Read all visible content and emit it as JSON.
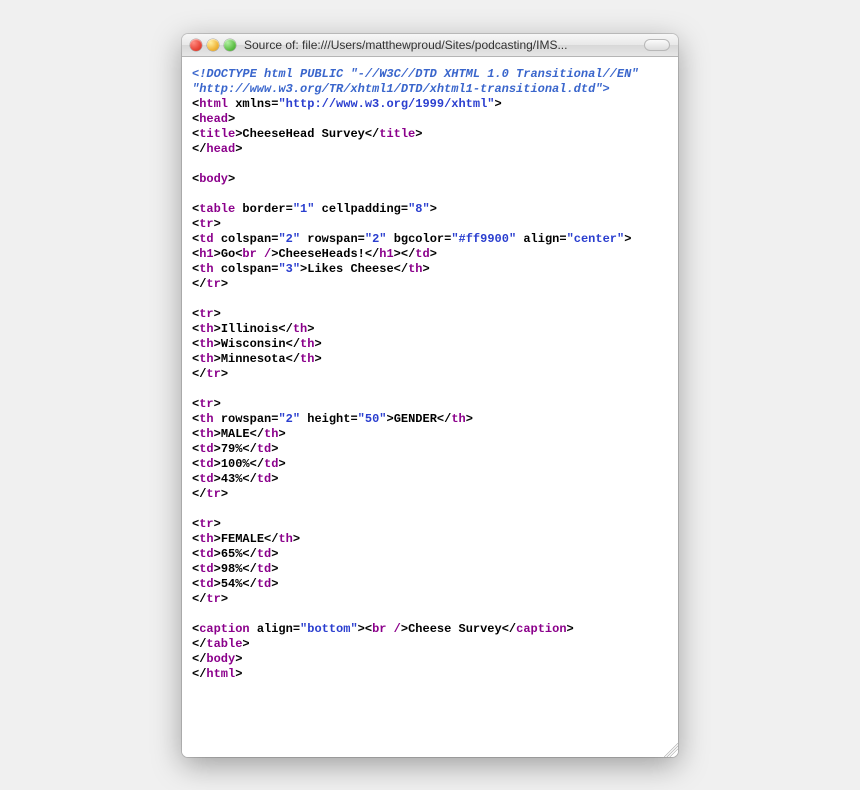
{
  "window": {
    "title": "Source of: file:///Users/matthewproud/Sites/podcasting/IMS..."
  },
  "src": {
    "doctype1": "<!DOCTYPE html PUBLIC \"-//W3C//DTD XHTML 1.0 Transitional//EN\"",
    "doctype2": "\"http://www.w3.org/TR/xhtml1/DTD/xhtml1-transitional.dtd\">",
    "html_ns_url": "http://www.w3.org/1999/xhtml",
    "title_text": "CheeseHead Survey",
    "table_border": "1",
    "table_cellpadding": "8",
    "td_colspan": "2",
    "td_rowspan": "2",
    "td_bgcolor": "#ff9900",
    "td_align": "center",
    "h1_text_a": "Go",
    "h1_text_b": "CheeseHeads!",
    "th_colspan": "3",
    "th_likes": "Likes Cheese",
    "th_il": "Illinois",
    "th_wi": "Wisconsin",
    "th_mn": "Minnesota",
    "th_g_rowspan": "2",
    "th_g_height": "50",
    "th_gender": "GENDER",
    "th_male": "MALE",
    "td_m1": "79%",
    "td_m2": "100%",
    "td_m3": "43%",
    "th_female": "FEMALE",
    "td_f1": "65%",
    "td_f2": "98%",
    "td_f3": "54%",
    "caption_align": "bottom",
    "caption_text": "Cheese Survey"
  }
}
